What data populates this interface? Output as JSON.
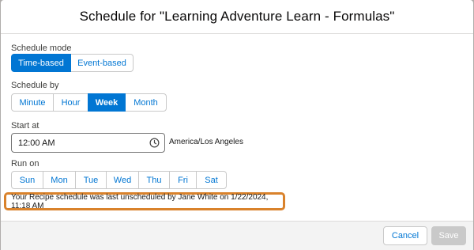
{
  "modal": {
    "title": "Schedule for \"Learning Adventure Learn - Formulas\""
  },
  "schedule_mode": {
    "label": "Schedule mode",
    "options": [
      "Time-based",
      "Event-based"
    ],
    "selected": "Time-based"
  },
  "schedule_by": {
    "label": "Schedule by",
    "options": [
      "Minute",
      "Hour",
      "Week",
      "Month"
    ],
    "selected": "Week"
  },
  "start_at": {
    "label": "Start at",
    "value": "12:00 AM",
    "timezone": "America/Los Angeles",
    "icon": "clock-icon"
  },
  "run_on": {
    "label": "Run on",
    "days": [
      "Sun",
      "Mon",
      "Tue",
      "Wed",
      "Thu",
      "Fri",
      "Sat"
    ]
  },
  "notice": {
    "text": "Your Recipe schedule was last unscheduled by Jane White on  1/22/2024, 11:18 AM",
    "highlight_color": "#d9822b"
  },
  "footer": {
    "cancel_label": "Cancel",
    "save_label": "Save"
  },
  "colors": {
    "accent": "#0176d3",
    "disabled": "#c9c9c9"
  }
}
